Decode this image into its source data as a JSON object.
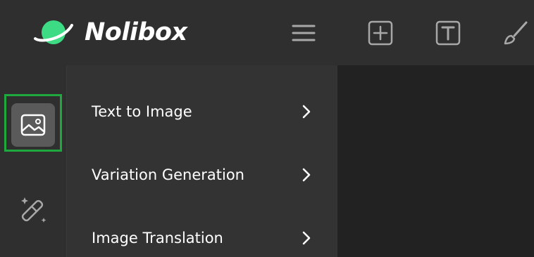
{
  "header": {
    "brand_name": "Nolibox",
    "logo_icon": "planet-logo-icon",
    "tools": [
      {
        "name": "menu-icon"
      },
      {
        "name": "add-frame-icon"
      },
      {
        "name": "text-tool-icon"
      },
      {
        "name": "brush-icon"
      }
    ]
  },
  "rail": {
    "items": [
      {
        "name": "image-icon",
        "active": true
      },
      {
        "name": "magic-wand-icon",
        "active": false
      }
    ],
    "highlight_color": "#1fa83e"
  },
  "submenu": {
    "items": [
      {
        "label": "Text to Image"
      },
      {
        "label": "Variation Generation"
      },
      {
        "label": "Image Translation"
      }
    ]
  },
  "colors": {
    "header_bg": "#2f2f2f",
    "panel_bg": "#333333",
    "canvas_bg": "#222222",
    "logo_green": "#3ddc84"
  }
}
